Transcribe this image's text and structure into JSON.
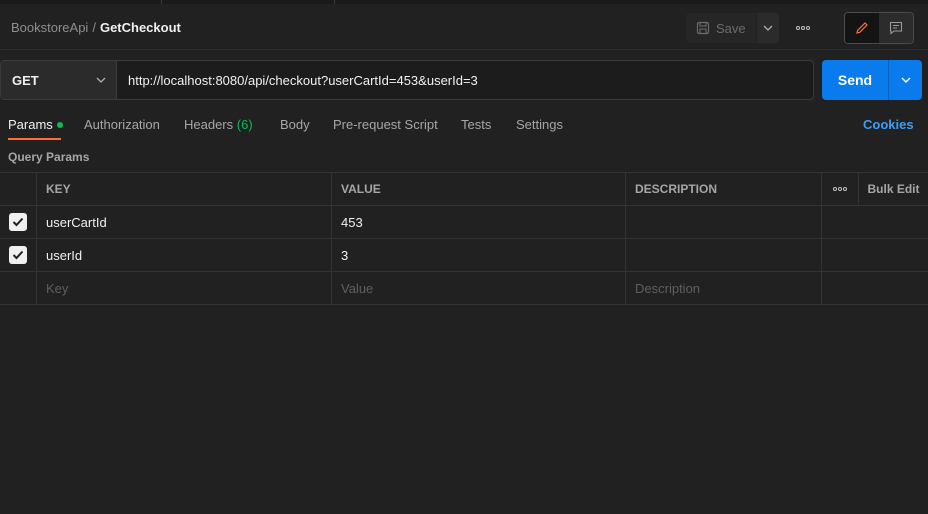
{
  "breadcrumb": {
    "collection": "BookstoreApi",
    "separator": "/",
    "request": "GetCheckout"
  },
  "toolbar": {
    "save_label": "Save"
  },
  "request": {
    "method": "GET",
    "url": "http://localhost:8080/api/checkout?userCartId=453&userId=3",
    "send_label": "Send"
  },
  "tabs": [
    {
      "label": "Params"
    },
    {
      "label": "Authorization"
    },
    {
      "label": "Headers",
      "count": "(6)"
    },
    {
      "label": "Body"
    },
    {
      "label": "Pre-request Script"
    },
    {
      "label": "Tests"
    },
    {
      "label": "Settings"
    }
  ],
  "cookies_label": "Cookies",
  "query_params": {
    "title": "Query Params",
    "columns": {
      "key": "KEY",
      "value": "VALUE",
      "description": "DESCRIPTION",
      "bulk_edit": "Bulk Edit"
    },
    "rows": [
      {
        "key": "userCartId",
        "value": "453",
        "description": "",
        "checked": true
      },
      {
        "key": "userId",
        "value": "3",
        "description": "",
        "checked": true
      }
    ],
    "placeholders": {
      "key": "Key",
      "value": "Value",
      "description": "Description"
    }
  },
  "colors": {
    "accent": "#ff6c37",
    "send": "#097bed",
    "active_dot": "#0cbb52",
    "link": "#3d9ef5",
    "background": "#212121"
  },
  "icons": {
    "save": "save-disk-icon",
    "edit": "pencil-icon",
    "comments": "comment-icon",
    "more": "more-dots-icon"
  }
}
